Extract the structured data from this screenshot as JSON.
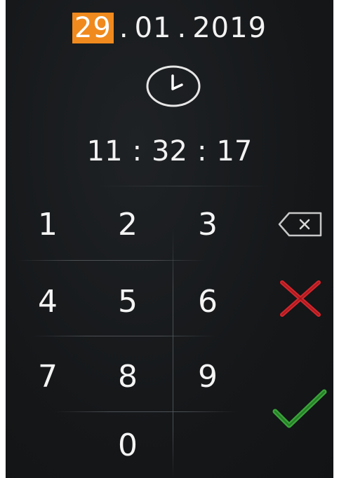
{
  "date": {
    "day": "29",
    "sep1": ".",
    "month": "01",
    "sep2": ".",
    "year": "2019"
  },
  "time": {
    "hours": "11",
    "sep1": ":",
    "minutes": "32",
    "sep2": ":",
    "seconds": "17"
  },
  "keypad": {
    "k1": "1",
    "k2": "2",
    "k3": "3",
    "k4": "4",
    "k5": "5",
    "k6": "6",
    "k7": "7",
    "k8": "8",
    "k9": "9",
    "k0": "0"
  },
  "icons": {
    "clock": "clock-icon",
    "backspace": "backspace-icon",
    "cancel": "cancel-x-icon",
    "confirm": "checkmark-icon"
  },
  "colors": {
    "background": "#151719",
    "highlight": "#f08a1e",
    "text": "#f2f2f2",
    "cancel": "#d4262c",
    "confirm": "#3aa53a",
    "backspace": "#c8c8c8"
  }
}
